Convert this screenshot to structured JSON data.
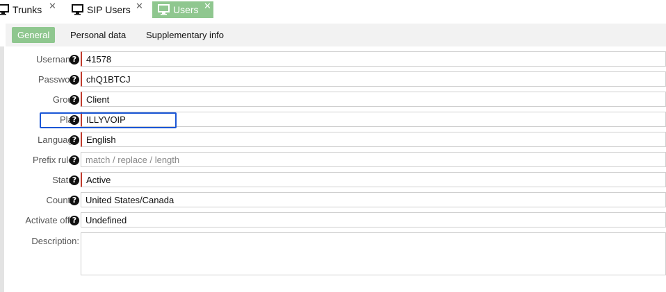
{
  "tabs": [
    {
      "label": "Trunks",
      "close": "✕"
    },
    {
      "label": "SIP Users",
      "close": "✕"
    },
    {
      "label": "Users",
      "close": "✕"
    }
  ],
  "subtabs": [
    "General",
    "Personal data",
    "Supplementary info"
  ],
  "help_glyph": "?",
  "form": {
    "username": {
      "label": "Username",
      "value": "41578"
    },
    "password": {
      "label": "Password",
      "value": "chQ1BTCJ"
    },
    "group": {
      "label": "Group",
      "value": "Client"
    },
    "plan": {
      "label": "Plan",
      "value": "ILLYVOIP"
    },
    "language": {
      "label": "Language",
      "value": "English"
    },
    "prefix_rules": {
      "label": "Prefix rules",
      "placeholder": "match / replace / length"
    },
    "status": {
      "label": "Status",
      "value": "Active"
    },
    "country": {
      "label": "Country",
      "value": "United States/Canada"
    },
    "activate_offer": {
      "label": "Activate offer",
      "value": "Undefined"
    },
    "description": {
      "label": "Description:",
      "value": ""
    }
  },
  "colors": {
    "active_tab": "#8fc78f",
    "required_mark": "#c0392b",
    "focus": "#1a56d6"
  }
}
